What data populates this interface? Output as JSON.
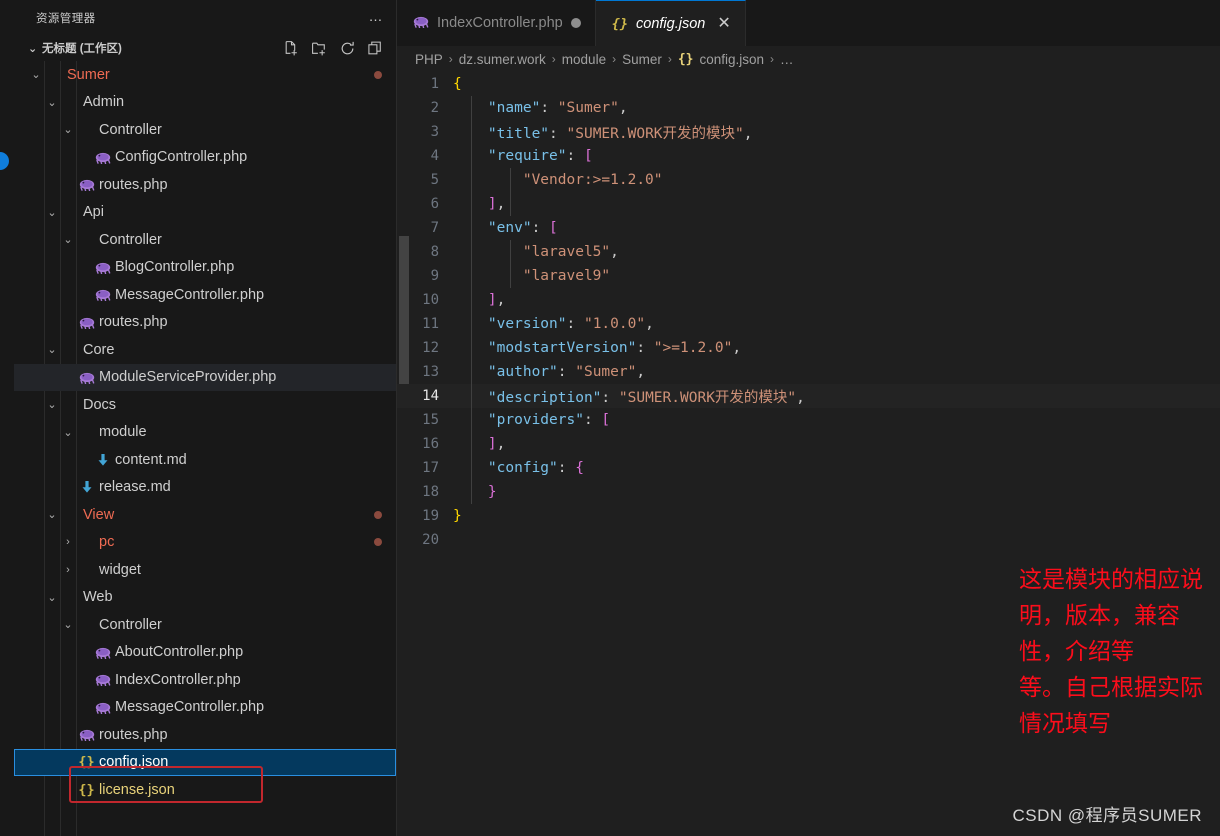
{
  "sidebar": {
    "title": "资源管理器",
    "more_label": "…",
    "workspace": {
      "name": "无标题 (工作区)",
      "chevron": "⌄"
    },
    "actions": [
      {
        "name": "new-file-icon",
        "tooltip": "新建文件"
      },
      {
        "name": "new-folder-icon",
        "tooltip": "新建文件夹"
      },
      {
        "name": "refresh-icon",
        "tooltip": "刷新资源管理器"
      },
      {
        "name": "collapse-all-icon",
        "tooltip": "在资源管理器中折叠文件夹"
      }
    ],
    "tree": [
      {
        "label": "Sumer",
        "type": "folder",
        "depth": 2,
        "expanded": true,
        "modified": true,
        "dot": "#8b4a3e"
      },
      {
        "label": "Admin",
        "type": "folder",
        "depth": 3,
        "expanded": true
      },
      {
        "label": "Controller",
        "type": "folder",
        "depth": 4,
        "expanded": true
      },
      {
        "label": "ConfigController.php",
        "type": "php",
        "depth": 5
      },
      {
        "label": "routes.php",
        "type": "php",
        "depth": 4
      },
      {
        "label": "Api",
        "type": "folder",
        "depth": 3,
        "expanded": true
      },
      {
        "label": "Controller",
        "type": "folder",
        "depth": 4,
        "expanded": true
      },
      {
        "label": "BlogController.php",
        "type": "php",
        "depth": 5
      },
      {
        "label": "MessageController.php",
        "type": "php",
        "depth": 5
      },
      {
        "label": "routes.php",
        "type": "php",
        "depth": 4
      },
      {
        "label": "Core",
        "type": "folder",
        "depth": 3,
        "expanded": true
      },
      {
        "label": "ModuleServiceProvider.php",
        "type": "php",
        "depth": 4,
        "focus": true
      },
      {
        "label": "Docs",
        "type": "folder",
        "depth": 3,
        "expanded": true
      },
      {
        "label": "module",
        "type": "folder",
        "depth": 4,
        "expanded": true
      },
      {
        "label": "content.md",
        "type": "md",
        "depth": 5
      },
      {
        "label": "release.md",
        "type": "md",
        "depth": 4
      },
      {
        "label": "View",
        "type": "folder",
        "depth": 3,
        "expanded": true,
        "modified": true,
        "dot": "#8b4a3e"
      },
      {
        "label": "pc",
        "type": "folder",
        "depth": 4,
        "expanded": false,
        "modified": true,
        "dot": "#8b4a3e"
      },
      {
        "label": "widget",
        "type": "folder",
        "depth": 4,
        "expanded": false
      },
      {
        "label": "Web",
        "type": "folder",
        "depth": 3,
        "expanded": true
      },
      {
        "label": "Controller",
        "type": "folder",
        "depth": 4,
        "expanded": true
      },
      {
        "label": "AboutController.php",
        "type": "php",
        "depth": 5
      },
      {
        "label": "IndexController.php",
        "type": "php",
        "depth": 5
      },
      {
        "label": "MessageController.php",
        "type": "php",
        "depth": 5
      },
      {
        "label": "routes.php",
        "type": "php",
        "depth": 4
      },
      {
        "label": "config.json",
        "type": "json",
        "depth": 4,
        "selected": true
      },
      {
        "label": "license.json",
        "type": "json",
        "depth": 4
      }
    ]
  },
  "tabs": [
    {
      "label": "IndexController.php",
      "icon": "php-icon",
      "active": false,
      "dirty": true
    },
    {
      "label": "config.json",
      "icon": "json-icon",
      "active": true,
      "dirty": false,
      "close": "✕"
    }
  ],
  "breadcrumb": {
    "items": [
      "PHP",
      "dz.sumer.work",
      "module",
      "Sumer",
      "config.json",
      "…"
    ],
    "separator": "›",
    "json_icon": "{}"
  },
  "code": {
    "language": "json",
    "active_line": 14,
    "lines": [
      {
        "n": 1,
        "tokens": [
          {
            "t": "{",
            "c": "b1"
          }
        ]
      },
      {
        "n": 2,
        "tokens": [
          {
            "t": "    ",
            "c": "p"
          },
          {
            "t": "\"name\"",
            "c": "k"
          },
          {
            "t": ": ",
            "c": "p"
          },
          {
            "t": "\"Sumer\"",
            "c": "s"
          },
          {
            "t": ",",
            "c": "p"
          }
        ]
      },
      {
        "n": 3,
        "tokens": [
          {
            "t": "    ",
            "c": "p"
          },
          {
            "t": "\"title\"",
            "c": "k"
          },
          {
            "t": ": ",
            "c": "p"
          },
          {
            "t": "\"SUMER.WORK开发的模块\"",
            "c": "s"
          },
          {
            "t": ",",
            "c": "p"
          }
        ]
      },
      {
        "n": 4,
        "tokens": [
          {
            "t": "    ",
            "c": "p"
          },
          {
            "t": "\"require\"",
            "c": "k"
          },
          {
            "t": ": ",
            "c": "p"
          },
          {
            "t": "[",
            "c": "b2"
          }
        ]
      },
      {
        "n": 5,
        "tokens": [
          {
            "t": "        ",
            "c": "p"
          },
          {
            "t": "\"Vendor:>=1.2.0\"",
            "c": "s"
          }
        ]
      },
      {
        "n": 6,
        "tokens": [
          {
            "t": "    ",
            "c": "p"
          },
          {
            "t": "]",
            "c": "b2"
          },
          {
            "t": ",",
            "c": "p"
          }
        ]
      },
      {
        "n": 7,
        "tokens": [
          {
            "t": "    ",
            "c": "p"
          },
          {
            "t": "\"env\"",
            "c": "k"
          },
          {
            "t": ": ",
            "c": "p"
          },
          {
            "t": "[",
            "c": "b2"
          }
        ]
      },
      {
        "n": 8,
        "tokens": [
          {
            "t": "        ",
            "c": "p"
          },
          {
            "t": "\"laravel5\"",
            "c": "s"
          },
          {
            "t": ",",
            "c": "p"
          }
        ]
      },
      {
        "n": 9,
        "tokens": [
          {
            "t": "        ",
            "c": "p"
          },
          {
            "t": "\"laravel9\"",
            "c": "s"
          }
        ]
      },
      {
        "n": 10,
        "tokens": [
          {
            "t": "    ",
            "c": "p"
          },
          {
            "t": "]",
            "c": "b2"
          },
          {
            "t": ",",
            "c": "p"
          }
        ]
      },
      {
        "n": 11,
        "tokens": [
          {
            "t": "    ",
            "c": "p"
          },
          {
            "t": "\"version\"",
            "c": "k"
          },
          {
            "t": ": ",
            "c": "p"
          },
          {
            "t": "\"1.0.0\"",
            "c": "s"
          },
          {
            "t": ",",
            "c": "p"
          }
        ]
      },
      {
        "n": 12,
        "tokens": [
          {
            "t": "    ",
            "c": "p"
          },
          {
            "t": "\"modstartVersion\"",
            "c": "k"
          },
          {
            "t": ": ",
            "c": "p"
          },
          {
            "t": "\">=1.2.0\"",
            "c": "s"
          },
          {
            "t": ",",
            "c": "p"
          }
        ]
      },
      {
        "n": 13,
        "tokens": [
          {
            "t": "    ",
            "c": "p"
          },
          {
            "t": "\"author\"",
            "c": "k"
          },
          {
            "t": ": ",
            "c": "p"
          },
          {
            "t": "\"Sumer\"",
            "c": "s"
          },
          {
            "t": ",",
            "c": "p"
          }
        ]
      },
      {
        "n": 14,
        "tokens": [
          {
            "t": "    ",
            "c": "p"
          },
          {
            "t": "\"description\"",
            "c": "k"
          },
          {
            "t": ": ",
            "c": "p"
          },
          {
            "t": "\"SUMER.WORK开发的模块\"",
            "c": "s"
          },
          {
            "t": ",",
            "c": "p"
          }
        ]
      },
      {
        "n": 15,
        "tokens": [
          {
            "t": "    ",
            "c": "p"
          },
          {
            "t": "\"providers\"",
            "c": "k"
          },
          {
            "t": ": ",
            "c": "p"
          },
          {
            "t": "[",
            "c": "b2"
          }
        ]
      },
      {
        "n": 16,
        "tokens": [
          {
            "t": "    ",
            "c": "p"
          },
          {
            "t": "]",
            "c": "b2"
          },
          {
            "t": ",",
            "c": "p"
          }
        ]
      },
      {
        "n": 17,
        "tokens": [
          {
            "t": "    ",
            "c": "p"
          },
          {
            "t": "\"config\"",
            "c": "k"
          },
          {
            "t": ": ",
            "c": "p"
          },
          {
            "t": "{",
            "c": "b2"
          }
        ]
      },
      {
        "n": 18,
        "tokens": [
          {
            "t": "    ",
            "c": "p"
          },
          {
            "t": "}",
            "c": "b2"
          }
        ]
      },
      {
        "n": 19,
        "tokens": [
          {
            "t": "}",
            "c": "b1"
          }
        ]
      },
      {
        "n": 20,
        "tokens": []
      }
    ]
  },
  "annotation": {
    "text": "这是模块的相应说明，版本，兼容性，介绍等\n等。自己根据实际情况填写",
    "color": "#fc0d1b"
  },
  "watermark": {
    "text": "CSDN @程序员SUMER"
  },
  "colors": {
    "accent": "#0078d4",
    "selection": "#04395e",
    "sidebar_bg": "#181818",
    "editor_bg": "#1f1f1f",
    "modified_fg": "#e2a08a",
    "json_fg": "#e8d27a",
    "annotation_red": "#fc0d1b"
  }
}
